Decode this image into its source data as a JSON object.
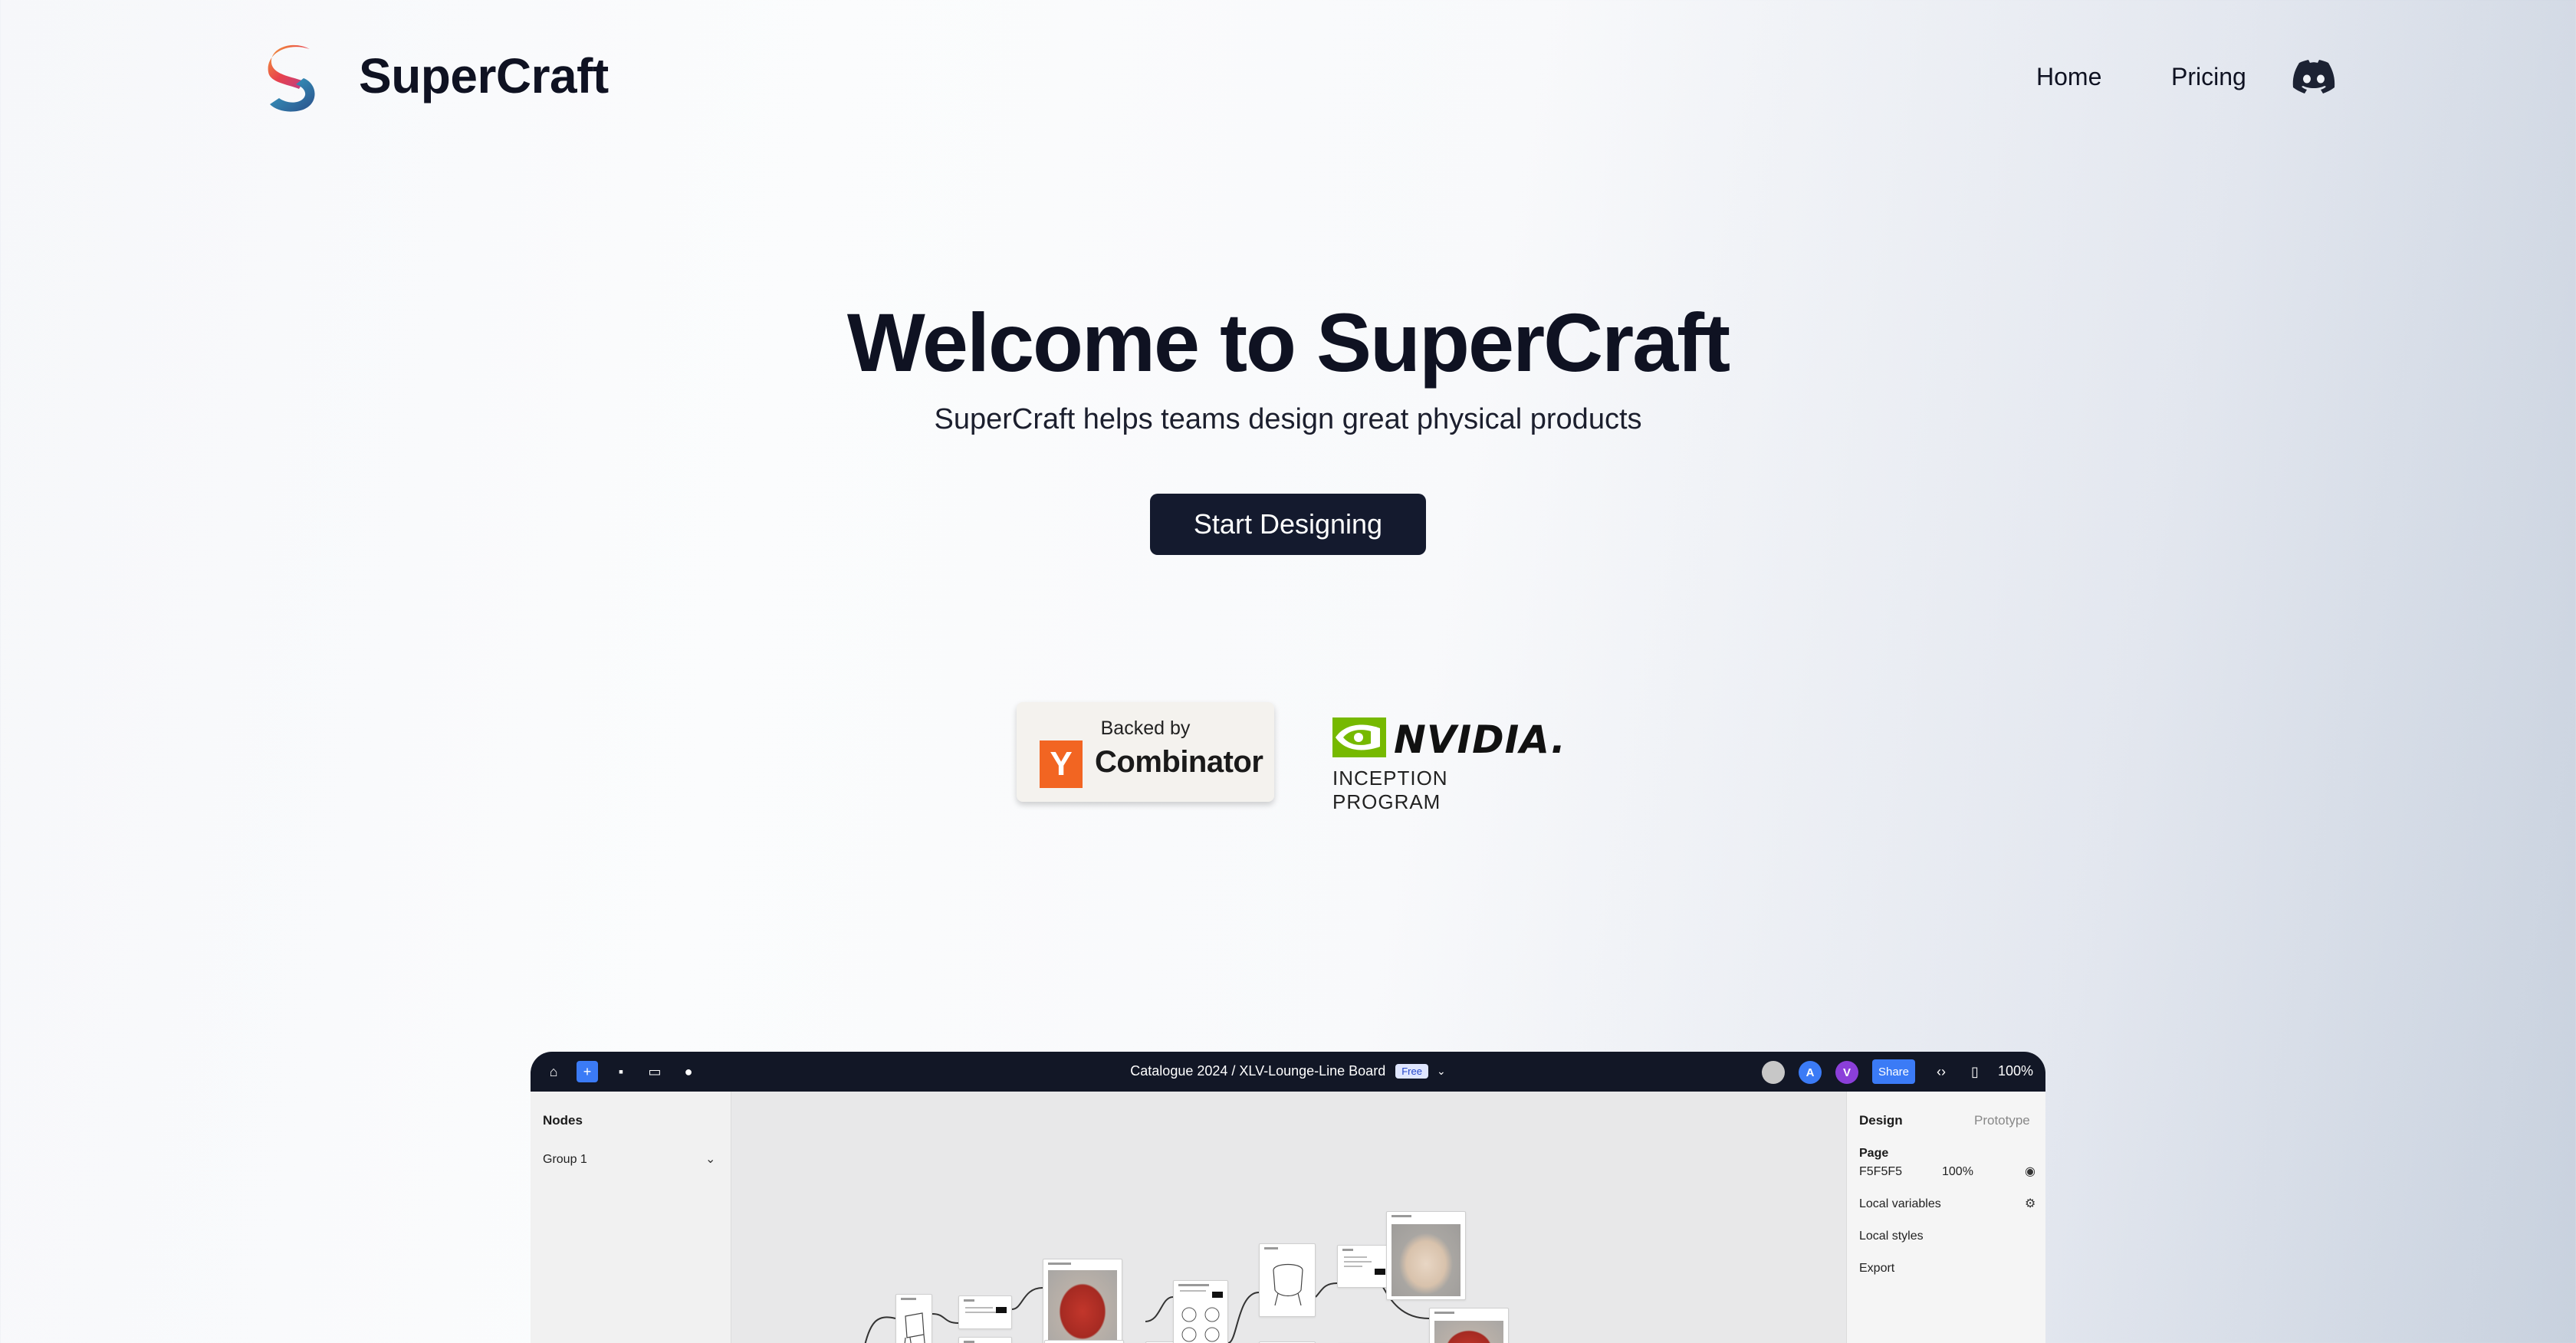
{
  "header": {
    "brand": "SuperCraft",
    "nav": {
      "home": "Home",
      "pricing": "Pricing"
    }
  },
  "hero": {
    "title": "Welcome to SuperCraft",
    "subtitle": "SuperCraft helps teams design great physical products",
    "cta": "Start Designing"
  },
  "backers": {
    "yc": {
      "backed": "Backed by",
      "letter": "Y",
      "name": "Combinator"
    },
    "nvidia": {
      "wordmark": "NVIDIA.",
      "program": "INCEPTION PROGRAM"
    }
  },
  "app": {
    "breadcrumb": "Catalogue 2024 / XLV-Lounge-Line Board",
    "plan_badge": "Free",
    "avatars": [
      "",
      "A",
      "V"
    ],
    "share": "Share",
    "zoom": "100%",
    "left_panel": {
      "title": "Nodes",
      "group": "Group 1"
    },
    "right_panel": {
      "tabs": [
        "Design",
        "Prototype"
      ],
      "page_label": "Page",
      "page_color": "F5F5F5",
      "page_opacity": "100%",
      "items": [
        "Local variables",
        "Local styles",
        "Export"
      ]
    }
  },
  "colors": {
    "primary": "#141a2e",
    "accent": "#3b7bf6",
    "yc_orange": "#f26522",
    "nvidia_green": "#76b900"
  }
}
